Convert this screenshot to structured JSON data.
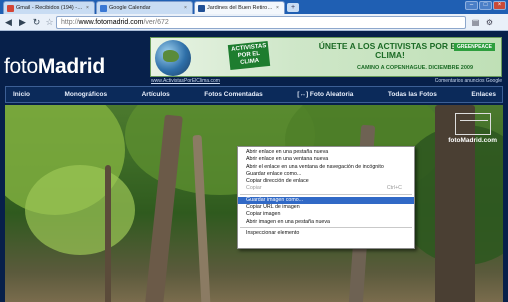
{
  "browser": {
    "tabs": [
      {
        "label": "Gmail - Recibidos (194) - ju...",
        "favicon_color": "#d44637"
      },
      {
        "label": "Google Calendar",
        "favicon_color": "#3a78d4"
      },
      {
        "label": "Jardines del Buen Retiro | ...",
        "favicon_color": "#1f4f96"
      }
    ],
    "new_tab": "+",
    "window_controls": {
      "minimize": "–",
      "maximize": "□",
      "close": "×"
    },
    "url_scheme": "http://",
    "url_host": "www.fotomadrid.com",
    "url_path": "/ver/672"
  },
  "site": {
    "logo_light": "foto",
    "logo_bold": "Madrid",
    "banner": {
      "badge": "ACTIVISTAS POR EL CLIMA",
      "headline": "ÚNETE A LOS ACTIVISTAS POR EL CLIMA!",
      "sub": "CAMINO A COPENHAGUE. DICIEMBRE 2009",
      "brand": "GREENPEACE",
      "link": "www.ActivistasPorElClima.com",
      "ads_label": "Comentarios  anuncios  Google"
    },
    "nav": [
      "Inicio",
      "Monográficos",
      "Artículos",
      "Fotos Comentadas",
      "[↔] Foto Aleatoria",
      "Todas las Fotos",
      "Enlaces"
    ],
    "watermark": "fotoMadrid.com"
  },
  "context_menu": {
    "groups": [
      [
        {
          "label": "Abrir enlace en una pestaña nueva",
          "enabled": true
        },
        {
          "label": "Abrir enlace en una ventana nueva",
          "enabled": true
        },
        {
          "label": "Abrir el enlace en una ventana de navegación de incógnito",
          "enabled": true
        },
        {
          "label": "Guardar enlace como...",
          "enabled": true
        },
        {
          "label": "Copiar dirección de enlace",
          "enabled": true
        },
        {
          "label": "Copiar",
          "enabled": false,
          "shortcut": "Ctrl+C"
        }
      ],
      [
        {
          "label": "Guardar imagen como...",
          "enabled": true,
          "highlighted": true
        },
        {
          "label": "Copiar URL de imagen",
          "enabled": true
        },
        {
          "label": "Copiar imagen",
          "enabled": true
        },
        {
          "label": "Abrir imagen en una pestaña nueva",
          "enabled": true
        }
      ],
      [
        {
          "label": "Inspeccionar elemento",
          "enabled": true
        }
      ]
    ]
  },
  "colors": {
    "page_bg": "#07204a",
    "menu_highlight": "#3169c6",
    "chrome_frame": "#1f5fb3"
  }
}
